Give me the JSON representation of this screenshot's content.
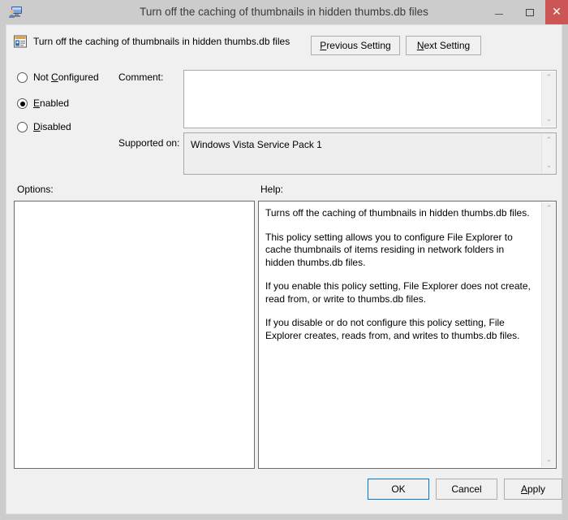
{
  "window": {
    "title": "Turn off the caching of thumbnails in hidden thumbs.db files",
    "icon": "group-policy-computer-icon",
    "controls": {
      "minimize": "–",
      "maximize": "□",
      "close": "✕"
    },
    "close_color": "#cc5555"
  },
  "header": {
    "icon": "policy-setting-icon",
    "title": "Turn off the caching of thumbnails in hidden thumbs.db files",
    "previous_button": "Previous Setting",
    "previous_accel": "P",
    "next_button": "Next Setting",
    "next_accel": "N"
  },
  "state": {
    "options": [
      {
        "label": "Not Configured",
        "accel": "C",
        "selected": false
      },
      {
        "label": "Enabled",
        "accel": "E",
        "selected": true
      },
      {
        "label": "Disabled",
        "accel": "D",
        "selected": false
      }
    ]
  },
  "comment": {
    "label": "Comment:",
    "value": "",
    "placeholder": ""
  },
  "supported": {
    "label": "Supported on:",
    "value": "Windows Vista Service Pack 1"
  },
  "panels": {
    "options_label": "Options:",
    "help_label": "Help:",
    "options_content": "",
    "help_paragraphs": [
      "Turns off the caching of thumbnails in hidden thumbs.db files.",
      "This policy setting allows you to configure File Explorer to cache thumbnails of items residing in network folders in hidden thumbs.db files.",
      "If you enable this policy setting, File Explorer does not create, read from, or write to thumbs.db files.",
      "If you disable or do not configure this policy setting, File Explorer creates, reads from, and writes to thumbs.db files."
    ]
  },
  "footer": {
    "ok": "OK",
    "cancel": "Cancel",
    "apply": "Apply",
    "apply_accel": "A",
    "focus_color": "#0078d7"
  },
  "scrollbars": {
    "up_arrow": "⌃",
    "down_arrow": "⌄"
  }
}
